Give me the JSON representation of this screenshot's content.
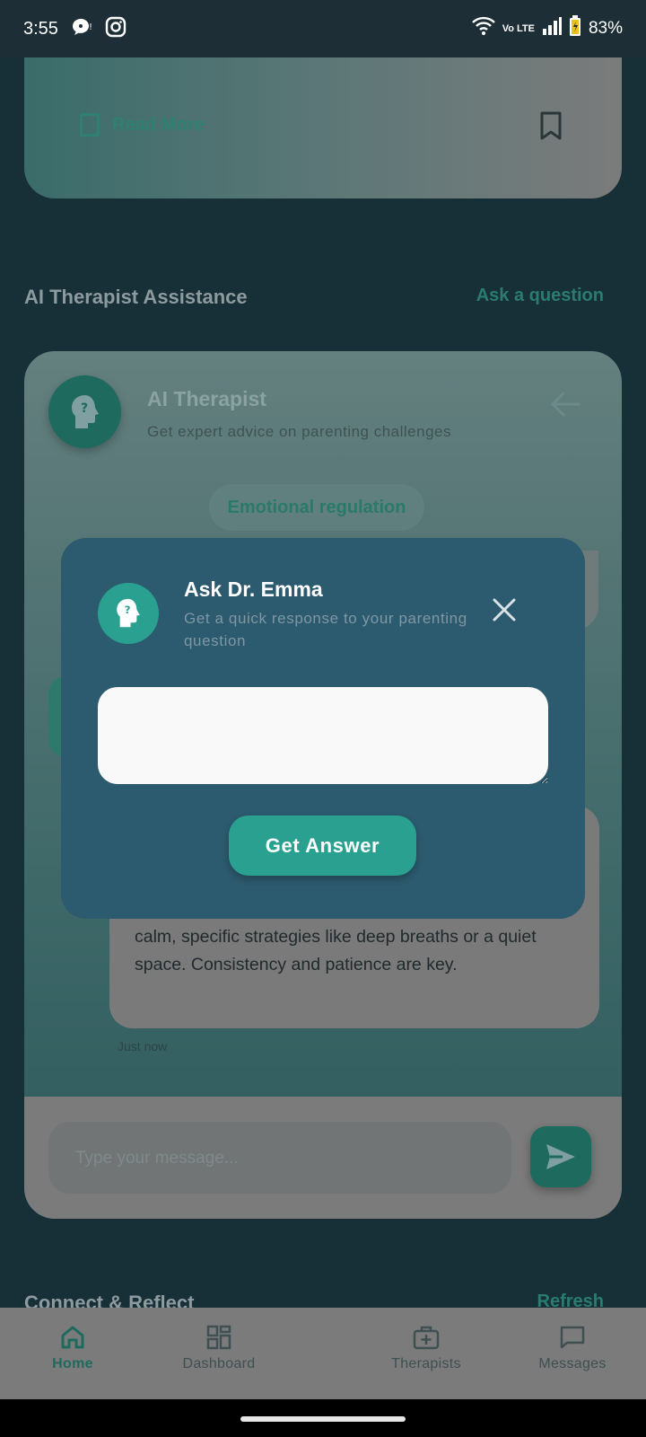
{
  "status_bar": {
    "time": "3:55",
    "battery": "83%",
    "network_badge": "Vo LTE",
    "icons": [
      "chat-bubble-icon",
      "instagram-icon",
      "wifi-icon",
      "signal-icon",
      "battery-icon"
    ]
  },
  "article_card": {
    "read_more": "Read More",
    "icons": [
      "book-icon",
      "bookmark-icon"
    ]
  },
  "ai_section": {
    "title": "AI Therapist Assistance",
    "link": "Ask a question"
  },
  "ai_card": {
    "title": "AI Therapist",
    "subtitle": "Get expert advice on parenting challenges",
    "topic_chip": "Emotional regulation",
    "bubble_text": "(\"It looks like you're feeling really angry\"). Then, offer calm, specific strategies like deep breaths or a quiet space.  Consistency and patience are key.",
    "bubble_time": "Just now",
    "input_placeholder": "Type your message...",
    "icons": [
      "head-question-icon",
      "back-arrow-icon",
      "send-icon"
    ]
  },
  "connect_section": {
    "title": "Connect & Reflect",
    "link": "Refresh"
  },
  "bottom_nav": {
    "items": [
      {
        "label": "Home",
        "icon": "home-icon",
        "active": true
      },
      {
        "label": "Dashboard",
        "icon": "dashboard-icon",
        "active": false
      },
      {
        "label": "Therapists",
        "icon": "medical-bag-icon",
        "active": false
      },
      {
        "label": "Messages",
        "icon": "message-icon",
        "active": false
      }
    ]
  },
  "dialog": {
    "title": "Ask Dr. Emma",
    "subtitle": "Get a quick response to your parenting question",
    "input_value": "",
    "button_label": "Get Answer",
    "icons": [
      "head-question-icon",
      "close-icon"
    ]
  },
  "colors": {
    "accent": "#2aa090",
    "dialog_bg": "#2c5a6e",
    "page_bg": "#173038"
  }
}
